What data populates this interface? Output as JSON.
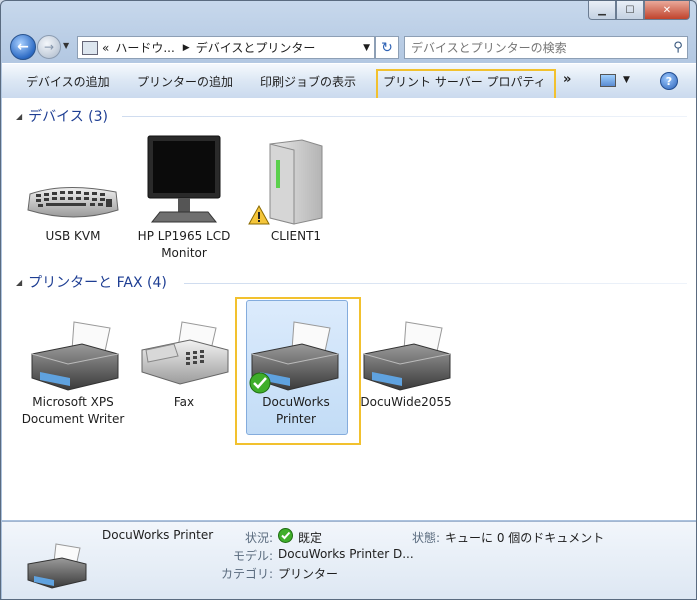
{
  "window": {
    "controls": {
      "minimize": "▁",
      "maximize": "☐",
      "close": "✕"
    }
  },
  "address_bar": {
    "prefix": "«",
    "segments": [
      "ハードウ...",
      "デバイスとプリンター"
    ],
    "dropdown_icon": "chevron-down-icon"
  },
  "search": {
    "placeholder": "デバイスとプリンターの検索"
  },
  "toolbar": {
    "add_device": "デバイスの追加",
    "add_printer": "プリンターの追加",
    "print_jobs": "印刷ジョブの表示",
    "print_server_properties": "プリント サーバー プロパティ",
    "more": "»",
    "help": "?"
  },
  "groups": {
    "devices": {
      "title": "デバイス (3)",
      "items": [
        {
          "label": "USB KVM",
          "icon": "keyboard-icon"
        },
        {
          "label": "HP LP1965 LCD Monitor",
          "icon": "monitor-icon"
        },
        {
          "label": "CLIENT1",
          "icon": "computer-tower-icon",
          "badge": "warning"
        }
      ]
    },
    "printers": {
      "title": "プリンターと FAX (4)",
      "items": [
        {
          "label": "Microsoft XPS Document Writer",
          "icon": "printer-icon"
        },
        {
          "label": "Fax",
          "icon": "fax-icon"
        },
        {
          "label": "DocuWorks Printer",
          "icon": "printer-icon",
          "badge": "default-check",
          "selected": true
        },
        {
          "label": "DocuWide2055",
          "icon": "printer-icon"
        }
      ]
    }
  },
  "details": {
    "name": "DocuWorks Printer",
    "status_label": "状況:",
    "status_value": "既定",
    "state_label": "状態:",
    "state_value": "キューに 0 個のドキュメント",
    "model_label": "モデル:",
    "model_value": "DocuWorks Printer D...",
    "category_label": "カテゴリ:",
    "category_value": "プリンター"
  },
  "colors": {
    "highlight": "#f2c12e",
    "group_title": "#1e3e93",
    "selection": "#c2dcf6"
  }
}
